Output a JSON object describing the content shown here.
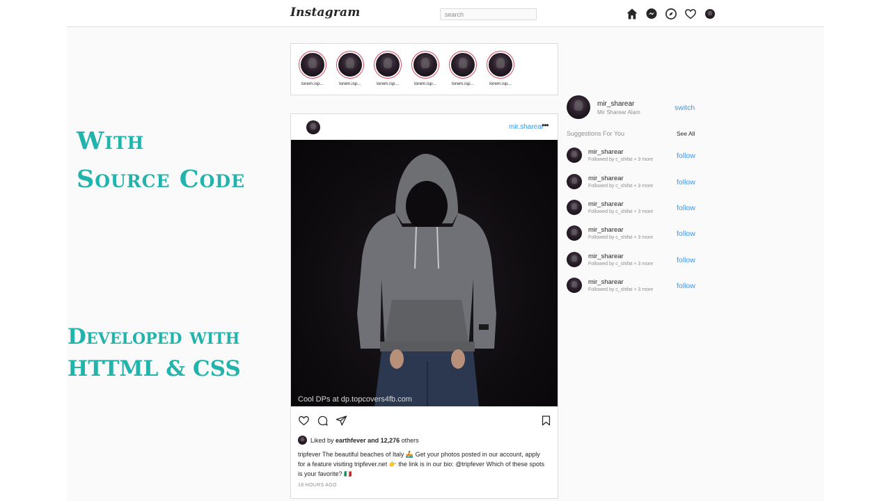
{
  "header": {
    "logo": "Instagram",
    "search_placeholder": "search",
    "nav_icons": [
      "home-icon",
      "messenger-icon",
      "explore-icon",
      "heart-icon",
      "profile-avatar"
    ]
  },
  "stories": [
    {
      "label": "lorem.isp..."
    },
    {
      "label": "lorem.isp..."
    },
    {
      "label": "lorem.isp..."
    },
    {
      "label": "lorem.isp..."
    },
    {
      "label": "lorem.isp..."
    },
    {
      "label": "lorem.isp..."
    }
  ],
  "post": {
    "username": "mir.sharear",
    "more": "•••",
    "watermark": "Cool DPs at dp.topcovers4fb.com",
    "liked_prefix": "Liked by ",
    "liked_user": "earthfever",
    "liked_mid": " and ",
    "liked_count": "12,276",
    "liked_suffix": " others",
    "caption_user": "tripfever",
    "caption_text": " The beautiful beaches of Italy 🚣 Get your photos posted in our account, apply for a feature visiting tripfever.net 👉 the link is in our bio: @tripfever Which of these spots is your favorite? 🇮🇹",
    "time": "18 HOURS AGO"
  },
  "sidebar": {
    "profile": {
      "handle": "mir_sharear",
      "name": "Mir Sharear Alam",
      "switch_label": "switch"
    },
    "suggestions_title": "Suggestions For You",
    "see_all": "See All",
    "suggestions": [
      {
        "name": "mir_sharear",
        "sub": "Followed by c_shifat + 3 more",
        "action": "follow"
      },
      {
        "name": "mir_sharear",
        "sub": "Followed by c_shifat + 3 more",
        "action": "follow"
      },
      {
        "name": "mir_sharear",
        "sub": "Followed by c_shifat + 3 more",
        "action": "follow"
      },
      {
        "name": "mir_sharear",
        "sub": "Followed by c_shifat + 3 more",
        "action": "follow"
      },
      {
        "name": "mir_sharear",
        "sub": "Followed by c_shifat + 3 more",
        "action": "follow"
      },
      {
        "name": "mir_sharear",
        "sub": "Followed by c_shifat + 3 more",
        "action": "follow"
      }
    ]
  },
  "overlay": {
    "line1": "With",
    "line2": "Source Code",
    "line3": "Developed with",
    "line4": "HTTML & CSS",
    "color": "#21b3ac"
  },
  "colors": {
    "link": "#3897f0",
    "story_ring": "#d6455a",
    "border": "#dbdbdb"
  }
}
